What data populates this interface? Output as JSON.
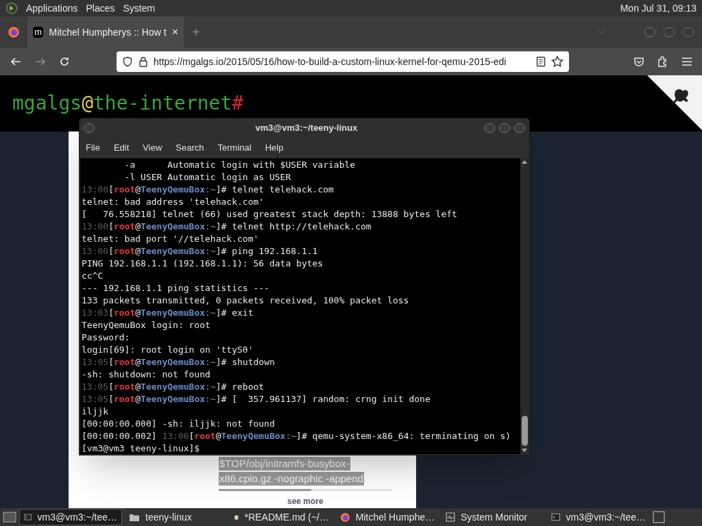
{
  "top_panel": {
    "menus": [
      "Applications",
      "Places",
      "System"
    ],
    "clock": "Mon Jul 31, 09:13"
  },
  "browser": {
    "tabs": [
      {
        "title": "Mitchel Humpherys :: How t",
        "favicon": "m",
        "close": "×",
        "selected": true
      }
    ],
    "new_tab": "+",
    "url": "https://mgalgs.io/2015/05/16/how-to-build-a-custom-linux-kernel-for-qemu-2015-edi",
    "forward_disabled": true
  },
  "page": {
    "header": [
      {
        "text": "mgalgs",
        "color": "#3aa43a"
      },
      {
        "text": "@",
        "color": "#e6d23a"
      },
      {
        "text": "the-internet",
        "color": "#3aa43a"
      },
      {
        "text": "#",
        "color": "#d22a2a"
      }
    ],
    "article_lines": [
      "$TOP/obj/initramfs-busybox-",
      "x86.cpio.gz -nographic -append"
    ],
    "see_more": "see more"
  },
  "terminal": {
    "title": "vm3@vm3:~/teeny-linux",
    "menu": [
      "File",
      "Edit",
      "View",
      "Search",
      "Terminal",
      "Help"
    ],
    "lines": [
      [
        {
          "t": "        -a      Automatic login with $USER variable",
          "kind": "plain"
        }
      ],
      [
        {
          "t": "        -l USER Automatic login as USER",
          "kind": "plain"
        }
      ],
      [
        {
          "t": "13:00",
          "kind": "time"
        },
        {
          "t": "[",
          "kind": "plain"
        },
        {
          "t": "root",
          "kind": "user"
        },
        {
          "t": "@",
          "kind": "plain"
        },
        {
          "t": "TeenyQemuBox",
          "kind": "host"
        },
        {
          "t": ":~",
          "kind": "path"
        },
        {
          "t": "]# telnet telehack.com",
          "kind": "plain"
        }
      ],
      [
        {
          "t": "telnet: bad address 'telehack.com'",
          "kind": "plain"
        }
      ],
      [
        {
          "t": "[   76.558218] telnet (66) used greatest stack depth: 13888 bytes left",
          "kind": "plain"
        }
      ],
      [
        {
          "t": "13:00",
          "kind": "time"
        },
        {
          "t": "[",
          "kind": "plain"
        },
        {
          "t": "root",
          "kind": "user"
        },
        {
          "t": "@",
          "kind": "plain"
        },
        {
          "t": "TeenyQemuBox",
          "kind": "host"
        },
        {
          "t": ":~",
          "kind": "path"
        },
        {
          "t": "]# telnet http://telehack.com",
          "kind": "plain"
        }
      ],
      [
        {
          "t": "telnet: bad port '//telehack.com'",
          "kind": "plain"
        }
      ],
      [
        {
          "t": "13:00",
          "kind": "time"
        },
        {
          "t": "[",
          "kind": "plain"
        },
        {
          "t": "root",
          "kind": "user"
        },
        {
          "t": "@",
          "kind": "plain"
        },
        {
          "t": "TeenyQemuBox",
          "kind": "host"
        },
        {
          "t": ":~",
          "kind": "path"
        },
        {
          "t": "]# ping 192.168.1.1",
          "kind": "plain"
        }
      ],
      [
        {
          "t": "PING 192.168.1.1 (192.168.1.1): 56 data bytes",
          "kind": "plain"
        }
      ],
      [
        {
          "t": "cc^C",
          "kind": "plain"
        }
      ],
      [
        {
          "t": "--- 192.168.1.1 ping statistics ---",
          "kind": "plain"
        }
      ],
      [
        {
          "t": "133 packets transmitted, 0 packets received, 100% packet loss",
          "kind": "plain"
        }
      ],
      [
        {
          "t": "13:03",
          "kind": "time"
        },
        {
          "t": "[",
          "kind": "plain"
        },
        {
          "t": "root",
          "kind": "user"
        },
        {
          "t": "@",
          "kind": "plain"
        },
        {
          "t": "TeenyQemuBox",
          "kind": "host"
        },
        {
          "t": ":~",
          "kind": "path"
        },
        {
          "t": "]# exit",
          "kind": "plain"
        }
      ],
      [
        {
          "t": "TeenyQemuBox login: root",
          "kind": "plain"
        }
      ],
      [
        {
          "t": "Password:",
          "kind": "plain"
        }
      ],
      [
        {
          "t": "login[69]: root login on 'ttyS0'",
          "kind": "plain"
        }
      ],
      [
        {
          "t": "13:05",
          "kind": "time"
        },
        {
          "t": "[",
          "kind": "plain"
        },
        {
          "t": "root",
          "kind": "user"
        },
        {
          "t": "@",
          "kind": "plain"
        },
        {
          "t": "TeenyQemuBox",
          "kind": "host"
        },
        {
          "t": ":~",
          "kind": "path"
        },
        {
          "t": "]# shutdown",
          "kind": "plain"
        }
      ],
      [
        {
          "t": "-sh: shutdown: not found",
          "kind": "plain"
        }
      ],
      [
        {
          "t": "13:05",
          "kind": "time"
        },
        {
          "t": "[",
          "kind": "plain"
        },
        {
          "t": "root",
          "kind": "user"
        },
        {
          "t": "@",
          "kind": "plain"
        },
        {
          "t": "TeenyQemuBox",
          "kind": "host"
        },
        {
          "t": ":~",
          "kind": "path"
        },
        {
          "t": "]# reboot",
          "kind": "plain"
        }
      ],
      [
        {
          "t": "13:05",
          "kind": "time"
        },
        {
          "t": "[",
          "kind": "plain"
        },
        {
          "t": "root",
          "kind": "user"
        },
        {
          "t": "@",
          "kind": "plain"
        },
        {
          "t": "TeenyQemuBox",
          "kind": "host"
        },
        {
          "t": ":~",
          "kind": "path"
        },
        {
          "t": "]# [  357.961137] random: crng init done",
          "kind": "plain"
        }
      ],
      [
        {
          "t": "iljjk",
          "kind": "plain"
        }
      ],
      [
        {
          "t": "[00:00:00.000] -sh: iljjk: not found",
          "kind": "plain"
        }
      ],
      [
        {
          "t": "[00:00:00.002] ",
          "kind": "plain"
        },
        {
          "t": "13:06",
          "kind": "time"
        },
        {
          "t": "[",
          "kind": "plain"
        },
        {
          "t": "root",
          "kind": "user"
        },
        {
          "t": "@",
          "kind": "plain"
        },
        {
          "t": "TeenyQemuBox",
          "kind": "host"
        },
        {
          "t": ":~",
          "kind": "path"
        },
        {
          "t": "]# qemu-system-x86_64: terminating on s)",
          "kind": "plain"
        }
      ],
      [
        {
          "t": "[vm3@vm3 teeny-linux]$",
          "kind": "plain"
        }
      ]
    ]
  },
  "taskbar": [
    {
      "label": "vm3@vm3:~/tee…",
      "kind": "terminal",
      "selected": true
    },
    {
      "label": "teeny-linux",
      "kind": "folder",
      "selected": false
    },
    {
      "label": "*README.md (~/…",
      "kind": "editor",
      "selected": false
    },
    {
      "label": "Mitchel Humphe…",
      "kind": "browser",
      "selected": false
    },
    {
      "label": "System Monitor",
      "kind": "monitor",
      "selected": false
    },
    {
      "label": "vm3@vm3:~/tee…",
      "kind": "terminal",
      "selected": false
    }
  ]
}
